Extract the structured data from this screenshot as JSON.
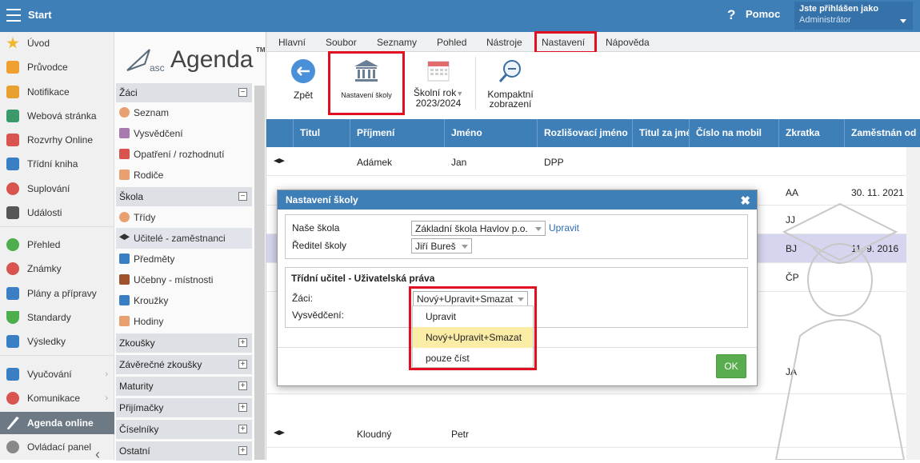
{
  "topbar": {
    "start": "Start",
    "help": "Pomoc",
    "user_line1": "Jste přihlášen jako",
    "user_line2": "Administrátor"
  },
  "leftnav": [
    {
      "label": "Úvod"
    },
    {
      "label": "Průvodce"
    },
    {
      "label": "Notifikace"
    },
    {
      "label": "Webová stránka"
    },
    {
      "label": "Rozvrhy Online"
    },
    {
      "label": "Třídní kniha"
    },
    {
      "label": "Suplování"
    },
    {
      "label": "Události"
    },
    {
      "label": "Přehled"
    },
    {
      "label": "Známky"
    },
    {
      "label": "Plány a přípravy"
    },
    {
      "label": "Standardy"
    },
    {
      "label": "Výsledky"
    },
    {
      "label": "Vyučování"
    },
    {
      "label": "Komunikace"
    },
    {
      "label": "Agenda online"
    },
    {
      "label": "Ovládací panel"
    }
  ],
  "logo": {
    "asc": "asc",
    "agenda": "Agenda",
    "tm": "TM"
  },
  "secnav": {
    "zaci": "Žáci",
    "zaci_items": [
      "Seznam",
      "Vysvědčení",
      "Opatření / rozhodnutí",
      "Rodiče"
    ],
    "skola": "Škola",
    "skola_items": [
      "Třídy",
      "Učitelé - zaměstnanci",
      "Předměty",
      "Učebny - místnosti",
      "Kroužky",
      "Hodiny"
    ],
    "collapsed": [
      "Zkoušky",
      "Závěrečné zkoušky",
      "Maturity",
      "Přijímačky",
      "Číselníky",
      "Ostatní"
    ]
  },
  "menubar": [
    "Hlavní",
    "Soubor",
    "Seznamy",
    "Pohled",
    "Nástroje",
    "Nastavení",
    "Nápověda"
  ],
  "toolbar": {
    "back": "Zpět",
    "school_settings": "Nastavení školy",
    "year_line1": "Školní rok",
    "year_line2": "2023/2024",
    "compact_line1": "Kompaktní",
    "compact_line2": "zobrazení"
  },
  "grid": {
    "headers": [
      "Titul",
      "Příjmení",
      "Jméno",
      "Rozlišovací jméno",
      "Titul za jmé",
      "Číslo na mobil",
      "Zkratka",
      "Zaměstnán od"
    ],
    "rows": [
      {
        "prijmeni": "Adámek",
        "jmeno": "Jan",
        "rozlis": "DPP",
        "zkratka": "",
        "od": ""
      },
      {
        "prijmeni": "",
        "jmeno": "",
        "rozlis": "",
        "zkratka": "AA",
        "od": "30. 11. 2021"
      },
      {
        "prijmeni": "",
        "jmeno": "",
        "rozlis": "",
        "zkratka": "JJ",
        "od": ""
      },
      {
        "prijmeni": "",
        "jmeno": "",
        "rozlis": "",
        "zkratka": "BJ",
        "od": "11. 9. 2016"
      },
      {
        "prijmeni": "",
        "jmeno": "",
        "rozlis": "",
        "zkratka": "ČP",
        "od": ""
      },
      {
        "prijmeni": "",
        "jmeno": "",
        "rozlis": "",
        "zkratka": "JA",
        "od": ""
      },
      {
        "prijmeni": "Kloudný",
        "jmeno": "Petr",
        "rozlis": "",
        "zkratka": "",
        "od": ""
      }
    ]
  },
  "modal": {
    "title": "Nastavení školy",
    "nase_skola_label": "Naše škola",
    "nase_skola_value": "Základní škola Havlov p.o.",
    "upravit_link": "Upravit",
    "reditel_label": "Ředitel školy",
    "reditel_value": "Jiří Bureš",
    "section_title": "Třídní učitel - Uživatelská práva",
    "zaci_label": "Žáci:",
    "zaci_value": "Nový+Upravit+Smazat",
    "vysvedceni_label": "Vysvědčení:",
    "ok": "OK"
  },
  "dropdown": {
    "options": [
      "Upravit",
      "Nový+Upravit+Smazat",
      "pouze číst"
    ],
    "highlighted_index": 1
  },
  "colors": {
    "accent": "#3f7fb8",
    "highlight_red": "#e01020",
    "ok_green": "#5aad4e"
  }
}
